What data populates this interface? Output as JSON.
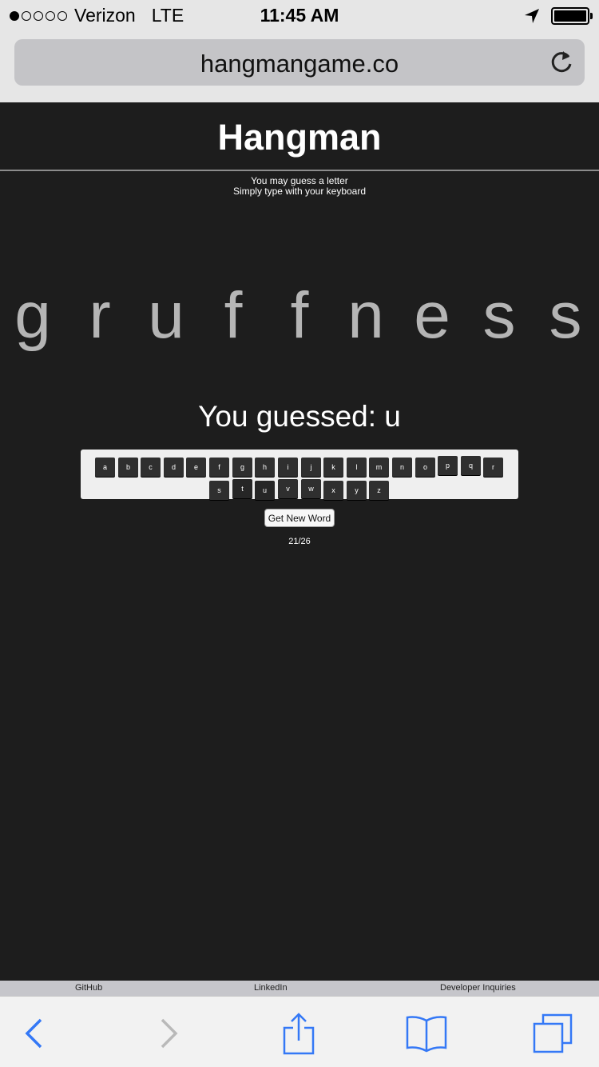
{
  "status_bar": {
    "carrier": "Verizon",
    "network": "LTE",
    "time": "11:45 AM",
    "signal_bars_filled": 1,
    "signal_bars_total": 5,
    "battery_level": 1.0
  },
  "browser": {
    "url": "hangmangame.co",
    "reload_icon": "reload-icon"
  },
  "game": {
    "title": "Hangman",
    "instruction_line1": "You may guess a letter",
    "instruction_line2": "Simply type with your keyboard",
    "word_letters": [
      "g",
      "r",
      "u",
      "f",
      "f",
      "n",
      "e",
      "s",
      "s"
    ],
    "guessed_text": "You guessed: u",
    "keyboard_row1": [
      "a",
      "b",
      "c",
      "d",
      "e",
      "f",
      "g",
      "h",
      "i",
      "j",
      "k",
      "l",
      "m",
      "n",
      "o",
      "p",
      "q",
      "r"
    ],
    "keyboard_row2": [
      "s",
      "t",
      "u",
      "v",
      "w",
      "x",
      "y",
      "z"
    ],
    "new_word_label": "Get New Word",
    "counter": "21/26"
  },
  "footer": {
    "links": [
      "GitHub",
      "LinkedIn",
      "Developer Inquiries"
    ]
  },
  "toolbar": {
    "icons": [
      "back-icon",
      "forward-icon",
      "share-icon",
      "bookmarks-icon",
      "tabs-icon"
    ]
  },
  "colors": {
    "page_background": "#1d1d1d",
    "word_letter": "#b5b5b5",
    "key_background": "#2f2f2f",
    "toolbar_accent": "#3478f6"
  }
}
